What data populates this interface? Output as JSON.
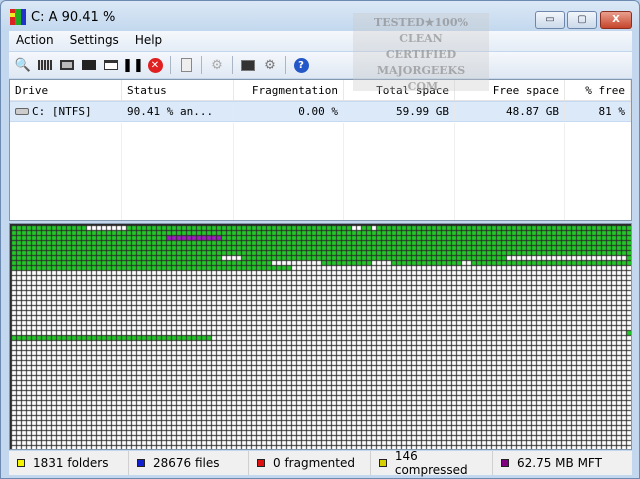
{
  "window": {
    "title": "C:  A  90.41 %",
    "watermark": "TESTED★100% CLEAN CERTIFIED MAJORGEEKS .COM",
    "minimize": "▭",
    "maximize": "▢",
    "close": "X"
  },
  "menu": [
    "Action",
    "Settings",
    "Help"
  ],
  "toolbar": [
    "search-icon",
    "analyze-icon",
    "defrag-icon",
    "dark-panel-icon",
    "window-icon",
    "pause-icon",
    "stop-icon",
    "report-icon",
    "gear-icon",
    "console-icon",
    "scheduler-icon",
    "help-icon"
  ],
  "list": {
    "headers": [
      "Drive",
      "Status",
      "Fragmentation",
      "Total space",
      "Free space",
      "% free"
    ],
    "rows": [
      {
        "drive": "C: [NTFS]",
        "status": "90.41 % an...",
        "fragmentation": "0.00 %",
        "total": "59.99 GB",
        "free": "48.87 GB",
        "pct_free": "81 %"
      }
    ]
  },
  "legend": [
    {
      "label": "1831 folders",
      "color": "#f4f400"
    },
    {
      "label": "28676 files",
      "color": "#1020d0"
    },
    {
      "label": "0 fragmented",
      "color": "#e01010"
    },
    {
      "label": "146 compressed",
      "color": "#d6d000"
    },
    {
      "label": "62.75 MB MFT",
      "color": "#800080"
    }
  ],
  "map_colors": {
    "used": "#22c828",
    "free": "#ffffff",
    "mft": "#a020c0",
    "grid": "#2a2a2a"
  }
}
